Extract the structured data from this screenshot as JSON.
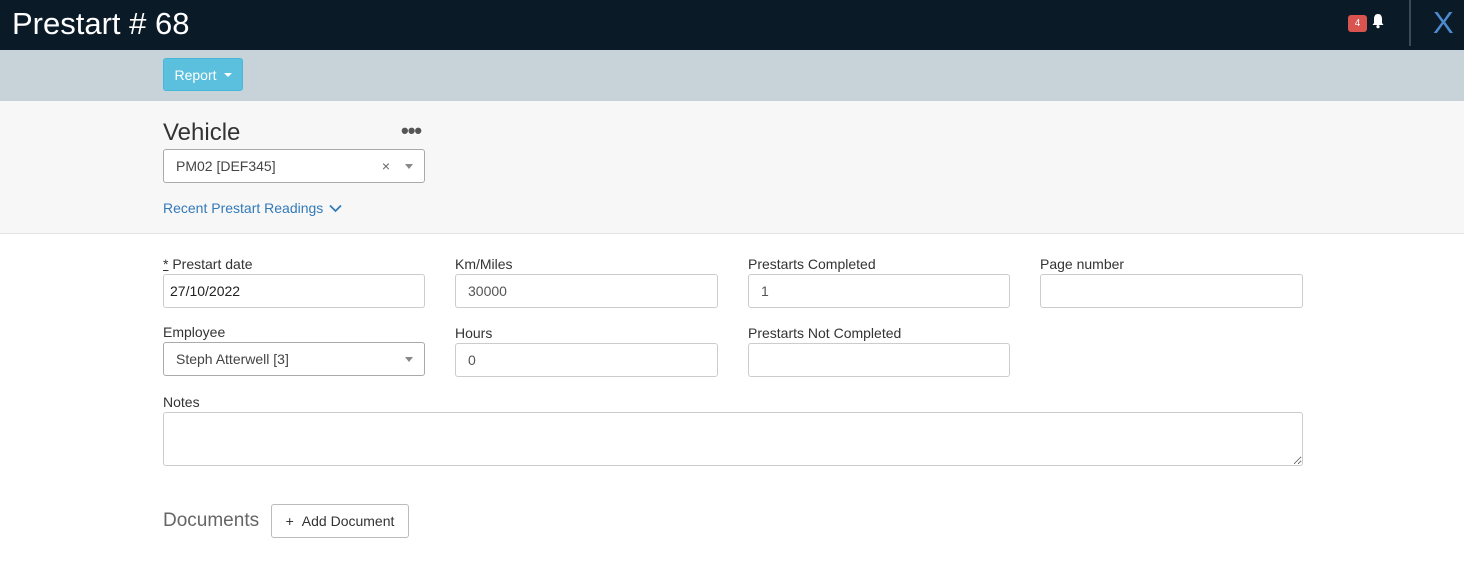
{
  "header": {
    "title": "Prestart # 68",
    "notification_count": "4",
    "close_label": "X"
  },
  "actionbar": {
    "report_label": "Report"
  },
  "vehicle": {
    "heading": "Vehicle",
    "more_label": "•••",
    "selected": "PM02 [DEF345]",
    "clear_glyph": "×",
    "recent_link": "Recent Prestart Readings"
  },
  "form": {
    "prestart_date_req": "*",
    "prestart_date_label": " Prestart date",
    "prestart_date_value": "27/10/2022",
    "km_label": "Km/Miles",
    "km_value": "30000",
    "completed_label": "Prestarts Completed",
    "completed_value": "1",
    "page_label": "Page number",
    "page_value": "",
    "employee_label": "Employee",
    "employee_value": "Steph Atterwell [3]",
    "hours_label": "Hours",
    "hours_value": "0",
    "not_completed_label": "Prestarts Not Completed",
    "not_completed_value": "",
    "notes_label": "Notes",
    "notes_value": ""
  },
  "documents": {
    "heading": "Documents",
    "add_icon": "+",
    "add_label": "Add Document"
  },
  "colors": {
    "topbar": "#0b1a27",
    "actionbar": "#c8d2d9",
    "accent_button": "#5bc0de",
    "link": "#337ab7",
    "badge": "#d9534f"
  }
}
